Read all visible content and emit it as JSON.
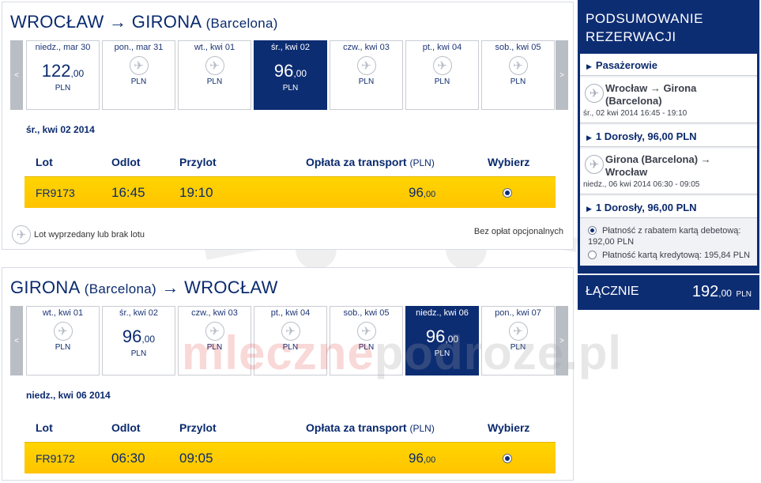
{
  "outbound": {
    "title_from": "WROCŁAW",
    "title_arrow": "→",
    "title_to": "GIRONA",
    "title_sub": "(Barcelona)",
    "prev": "<",
    "next": ">",
    "days": [
      {
        "label": "niedz., mar 30",
        "price": "122",
        "dec": ",00",
        "currency": "PLN",
        "has_price": true,
        "selected": false
      },
      {
        "label": "pon., mar 31",
        "price": "",
        "dec": "",
        "currency": "PLN",
        "has_price": false,
        "selected": false
      },
      {
        "label": "wt., kwi 01",
        "price": "",
        "dec": "",
        "currency": "PLN",
        "has_price": false,
        "selected": false
      },
      {
        "label": "śr., kwi 02",
        "price": "96",
        "dec": ",00",
        "currency": "PLN",
        "has_price": true,
        "selected": true
      },
      {
        "label": "czw., kwi 03",
        "price": "",
        "dec": "",
        "currency": "PLN",
        "has_price": false,
        "selected": false
      },
      {
        "label": "pt., kwi 04",
        "price": "",
        "dec": "",
        "currency": "PLN",
        "has_price": false,
        "selected": false
      },
      {
        "label": "sob., kwi 05",
        "price": "",
        "dec": "",
        "currency": "PLN",
        "has_price": false,
        "selected": false
      }
    ],
    "selected_date": "śr., kwi 02 2014",
    "headers": {
      "flight": "Lot",
      "depart": "Odlot",
      "arrive": "Przylot",
      "fare": "Opłata za transport",
      "fare_unit": "(PLN)",
      "select": "Wybierz"
    },
    "flight": {
      "number": "FR9173",
      "depart": "16:45",
      "arrive": "19:10",
      "price": "96",
      "dec": ",00"
    },
    "legend": "Lot wyprzedany lub brak lotu",
    "no_options": "Bez opłat opcjonalnych"
  },
  "return": {
    "title_from": "GIRONA",
    "title_sub": "(Barcelona)",
    "title_arrow": "→",
    "title_to": "WROCŁAW",
    "prev": "<",
    "next": ">",
    "days": [
      {
        "label": "wt., kwi 01",
        "price": "",
        "dec": "",
        "currency": "PLN",
        "has_price": false,
        "selected": false
      },
      {
        "label": "śr., kwi 02",
        "price": "96",
        "dec": ",00",
        "currency": "PLN",
        "has_price": true,
        "selected": false
      },
      {
        "label": "czw., kwi 03",
        "price": "",
        "dec": "",
        "currency": "PLN",
        "has_price": false,
        "selected": false
      },
      {
        "label": "pt., kwi 04",
        "price": "",
        "dec": "",
        "currency": "PLN",
        "has_price": false,
        "selected": false
      },
      {
        "label": "sob., kwi 05",
        "price": "",
        "dec": "",
        "currency": "PLN",
        "has_price": false,
        "selected": false
      },
      {
        "label": "niedz., kwi 06",
        "price": "96",
        "dec": ",00",
        "currency": "PLN",
        "has_price": true,
        "selected": true
      },
      {
        "label": "pon., kwi 07",
        "price": "",
        "dec": "",
        "currency": "PLN",
        "has_price": false,
        "selected": false
      }
    ],
    "selected_date": "niedz., kwi 06 2014",
    "headers": {
      "flight": "Lot",
      "depart": "Odlot",
      "arrive": "Przylot",
      "fare": "Opłata za transport",
      "fare_unit": "(PLN)",
      "select": "Wybierz"
    },
    "flight": {
      "number": "FR9172",
      "depart": "06:30",
      "arrive": "09:05",
      "price": "96",
      "dec": ",00"
    }
  },
  "summary": {
    "title_line1": "PODSUMOWANIE",
    "title_line2": "REZERWACJI",
    "passengers": "Pasażerowie",
    "route1": "Wrocław → Girona (Barcelona)",
    "route1_date": "śr., 02 kwi 2014 16:45 - 19:10",
    "route1_pax": "1 Dorosły, 96,00 PLN",
    "route2": "Girona (Barcelona) → Wrocław",
    "route2_date": "niedz., 06 kwi 2014 06:30 - 09:05",
    "route2_pax": "1 Dorosły, 96,00 PLN",
    "pay_debit": "Płatność z rabatem kartą debetową:",
    "pay_debit_value": "192,00 PLN",
    "pay_credit": "Płatność kartą kredytową: 195,84 PLN",
    "total_label": "ŁĄCZNIE",
    "total_value": "192",
    "total_dec": ",00",
    "total_currency": "PLN"
  },
  "watermark": {
    "left": "mleczne",
    "right": "podroze.pl"
  },
  "colors": {
    "navy": "#0d2d73",
    "yellow": "#ffd400",
    "grey_arrow": "#b9bdc4"
  }
}
